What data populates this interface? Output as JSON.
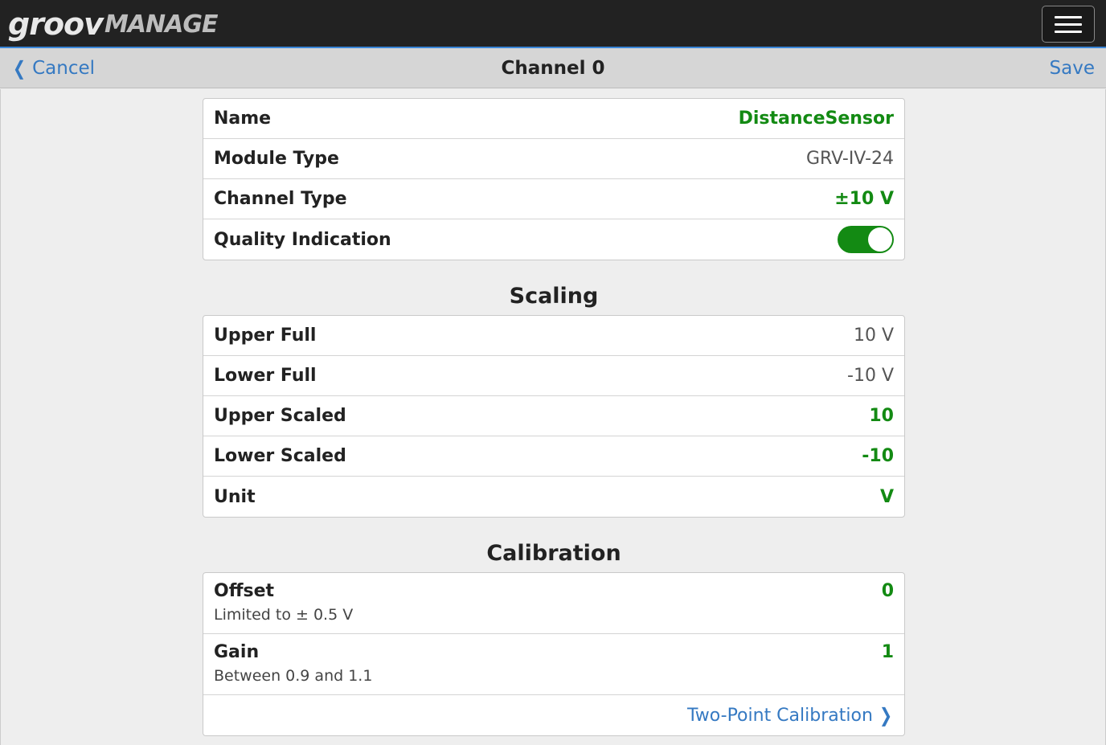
{
  "app": {
    "logo_groov": "groov",
    "logo_manage": "MANAGE"
  },
  "navbar": {
    "cancel_label": "Cancel",
    "title": "Channel 0",
    "save_label": "Save"
  },
  "general": {
    "rows": [
      {
        "label": "Name",
        "value": "DistanceSensor"
      },
      {
        "label": "Module Type",
        "value": "GRV-IV-24"
      },
      {
        "label": "Channel Type",
        "value": "±10 V"
      },
      {
        "label": "Quality Indication",
        "value": true
      }
    ]
  },
  "scaling": {
    "title": "Scaling",
    "rows": [
      {
        "label": "Upper Full",
        "value": "10 V"
      },
      {
        "label": "Lower Full",
        "value": "-10 V"
      },
      {
        "label": "Upper Scaled",
        "value": "10"
      },
      {
        "label": "Lower Scaled",
        "value": "-10"
      },
      {
        "label": "Unit",
        "value": "V"
      }
    ]
  },
  "calibration": {
    "title": "Calibration",
    "rows": [
      {
        "label": "Offset",
        "sub": "Limited to ± 0.5 V",
        "value": "0"
      },
      {
        "label": "Gain",
        "sub": "Between 0.9 and 1.1",
        "value": "1"
      }
    ],
    "two_point_label": "Two-Point Calibration"
  },
  "colors": {
    "accent_blue": "#3579c2",
    "value_green": "#138a13",
    "topbar": "#222222"
  }
}
